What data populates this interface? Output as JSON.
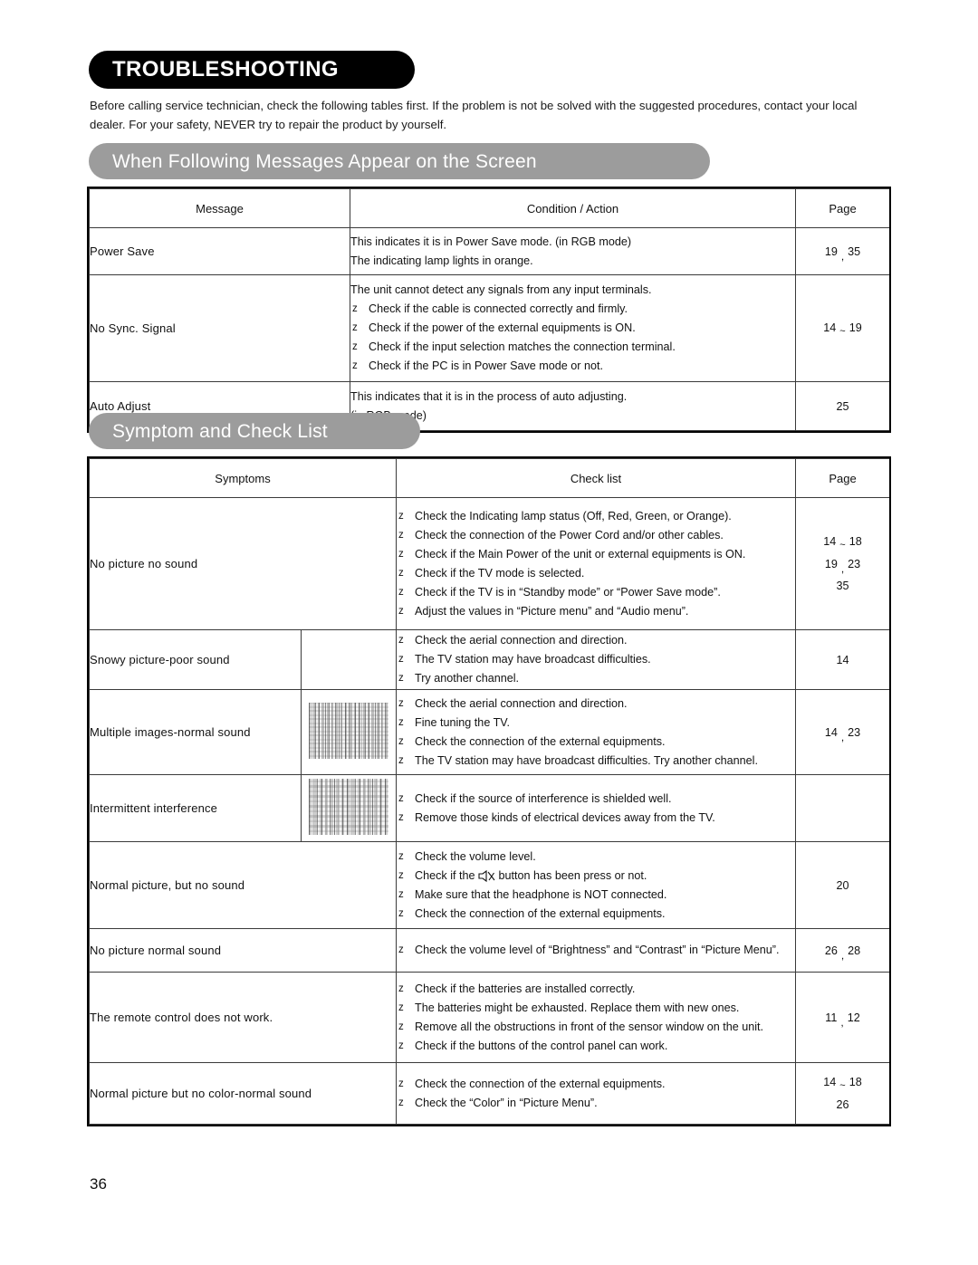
{
  "document": {
    "title": "TROUBLESHOOTING",
    "intro": "Before calling service technician, check the following tables first. If the problem is not be solved with the suggested procedures, contact your local dealer. For your safety, NEVER try to repair the product by yourself.",
    "folio": "36"
  },
  "colors": {
    "title_pill_bg": "#000000",
    "banner_bg": "#9c9c9c",
    "text": "#111111",
    "table_border": "#3a3a3a",
    "frame_border": "#000000"
  },
  "section_1": {
    "banner": "When Following Messages Appear on the Screen",
    "table": {
      "headers": [
        "Message",
        "Condition / Action",
        "Page"
      ],
      "rows": [
        {
          "message": "Power Save",
          "lines": [
            {
              "bullet": false,
              "text": "This indicates it is in Power Save mode. (in RGB mode)"
            },
            {
              "bullet": false,
              "text": "The indicating lamp lights in orange."
            }
          ],
          "page": {
            "a": "19",
            "sep": ",",
            "b": "35"
          }
        },
        {
          "message": "No Sync. Signal",
          "lines": [
            {
              "bullet": false,
              "text": "The unit cannot detect any signals from any input terminals."
            },
            {
              "bullet": true,
              "text": "Check if the cable is connected correctly and firmly."
            },
            {
              "bullet": true,
              "text": "Check if the power of the external equipments is ON."
            },
            {
              "bullet": true,
              "text": "Check if the input selection matches the connection terminal."
            },
            {
              "bullet": true,
              "text": "Check if the PC is in Power Save mode or not."
            }
          ],
          "page": {
            "a": "14",
            "sep": "~",
            "b": "19"
          }
        },
        {
          "message": "Auto Adjust",
          "lines": [
            {
              "bullet": false,
              "text": "This indicates that it is in the process of auto adjusting."
            },
            {
              "bullet": false,
              "text": "(in RGB mode)"
            }
          ],
          "page": {
            "a": "25",
            "sep": "",
            "b": ""
          }
        }
      ]
    }
  },
  "section_2": {
    "banner": "Symptom and Check List",
    "table": {
      "headers": [
        "Symptoms",
        "Check list",
        "Page"
      ],
      "rows": [
        {
          "symptom": "No picture   no sound",
          "thumb": "",
          "lines": [
            {
              "bullet": true,
              "text": "Check the Indicating lamp status (Off, Red, Green, or Orange)."
            },
            {
              "bullet": true,
              "text": "Check the connection of the Power Cord and/or other cables."
            },
            {
              "bullet": true,
              "text": "Check if the Main Power of the unit or external equipments is ON."
            },
            {
              "bullet": true,
              "text": "Check if the TV mode is selected."
            },
            {
              "bullet": true,
              "text": "Check if the TV is in “Standby mode” or “Power Save mode”."
            },
            {
              "bullet": true,
              "text": "Adjust the values in “Picture menu” and “Audio menu”."
            }
          ],
          "page_lines": [
            {
              "a": "14",
              "sep": "~",
              "b": "18"
            },
            {
              "a": "19",
              "sep": ",",
              "b": "23"
            },
            {
              "a": "35",
              "sep": "",
              "b": ""
            }
          ]
        },
        {
          "symptom": "Snowy picture-poor sound",
          "thumb": "",
          "lines": [
            {
              "bullet": true,
              "text": "Check the aerial connection and direction."
            },
            {
              "bullet": true,
              "text": "The TV station may have broadcast difficulties."
            },
            {
              "bullet": true,
              "text": "Try another channel."
            }
          ],
          "page_lines": [
            {
              "a": "14",
              "sep": "",
              "b": ""
            }
          ]
        },
        {
          "symptom": "Multiple images-normal sound",
          "thumb": "tv-noise-thumbnail",
          "lines": [
            {
              "bullet": true,
              "text": "Check the aerial connection and direction."
            },
            {
              "bullet": true,
              "text": "Fine tuning the TV."
            },
            {
              "bullet": true,
              "text": "Check the connection of the external equipments."
            },
            {
              "bullet": true,
              "text": "The TV station may have broadcast difficulties. Try another channel."
            }
          ],
          "page_lines": [
            {
              "a": "14",
              "sep": ",",
              "b": "23"
            }
          ]
        },
        {
          "symptom": "Intermittent interference",
          "thumb": "tv-noise-thumbnail",
          "lines": [
            {
              "bullet": true,
              "text": "Check if the source of interference is shielded well."
            },
            {
              "bullet": true,
              "text": "Remove those kinds of electrical devices away from the TV."
            }
          ],
          "page_lines": []
        },
        {
          "symptom": "Normal picture, but no sound",
          "thumb": "",
          "lines": [
            {
              "bullet": true,
              "text": "Check the volume level."
            },
            {
              "bullet": true,
              "icon": "mute-icon",
              "text_before": "Check if the ",
              "text_after": " button has been press or not."
            },
            {
              "bullet": true,
              "text": "Make sure that the headphone is NOT connected."
            },
            {
              "bullet": true,
              "text": "Check the connection of the external equipments."
            }
          ],
          "page_lines": [
            {
              "a": "20",
              "sep": "",
              "b": ""
            }
          ]
        },
        {
          "symptom": "No picture   normal sound",
          "thumb": "",
          "lines": [
            {
              "bullet": true,
              "text": "Check the volume level of “Brightness” and “Contrast” in “Picture Menu”."
            }
          ],
          "page_lines": [
            {
              "a": "26",
              "sep": ",",
              "b": "28"
            }
          ]
        },
        {
          "symptom": "The remote control does not work.",
          "thumb": "",
          "lines": [
            {
              "bullet": true,
              "text": "Check if the batteries are installed correctly."
            },
            {
              "bullet": true,
              "text": "The batteries might be exhausted. Replace them with new ones."
            },
            {
              "bullet": true,
              "text": "Remove all the obstructions in front of the sensor window on the unit."
            },
            {
              "bullet": true,
              "text": "Check if the buttons of the control panel can work."
            }
          ],
          "page_lines": [
            {
              "a": "11",
              "sep": ",",
              "b": "12"
            }
          ]
        },
        {
          "symptom": "Normal picture but no color-normal sound",
          "thumb": "",
          "lines": [
            {
              "bullet": true,
              "text": "Check the connection of the external equipments."
            },
            {
              "bullet": true,
              "text": "Check the “Color” in “Picture Menu”."
            }
          ],
          "page_lines": [
            {
              "a": "14",
              "sep": "~",
              "b": "18"
            },
            {
              "a": "26",
              "sep": "",
              "b": ""
            }
          ]
        }
      ]
    }
  },
  "bullet_glyph": "z"
}
